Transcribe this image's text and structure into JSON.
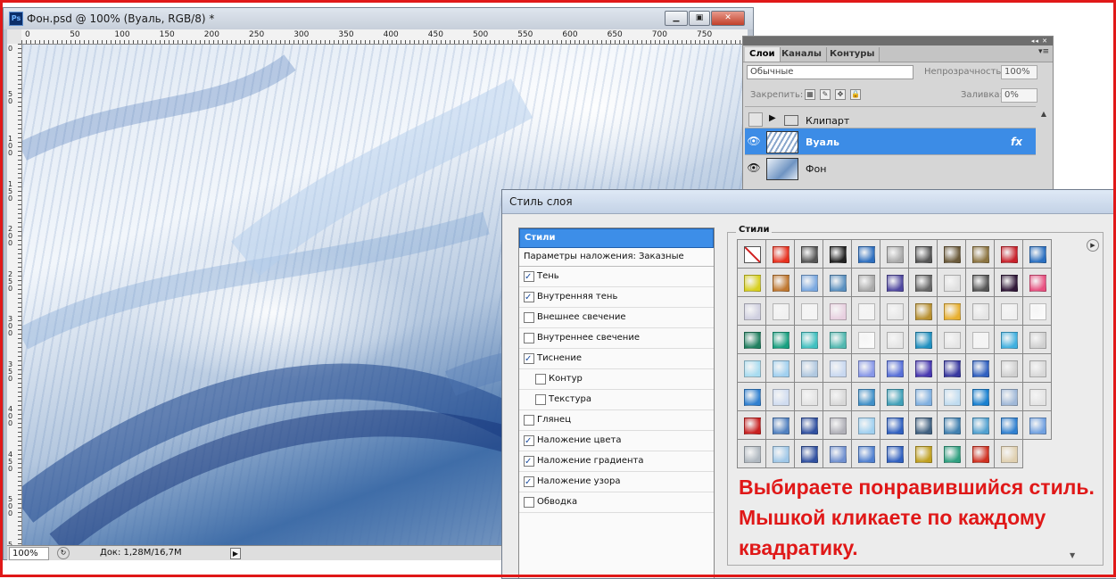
{
  "document": {
    "title": "Фон.psd @ 100% (Вуаль, RGB/8) *",
    "window_buttons": {
      "minimize": "▁",
      "restore": "▣",
      "close": "✕"
    },
    "ruler_top_labels": [
      "0",
      "50",
      "100",
      "150",
      "200",
      "250",
      "300",
      "350",
      "400",
      "450",
      "500",
      "550",
      "600",
      "650",
      "700",
      "750"
    ],
    "ruler_left_labels": [
      "0",
      "5 0",
      "1 0 0",
      "1 5 0",
      "2 0 0",
      "2 5 0",
      "3 0 0",
      "3 5 0",
      "4 0 0",
      "4 5 0",
      "5 0 0",
      "5"
    ],
    "zoom": "100%",
    "doc_info": "Док: 1,28M/16,7M",
    "play_arrow": "▶",
    "zoom_icon": "↻"
  },
  "layers_panel": {
    "collapse_glyph": "◂◂ ✕",
    "tabs": [
      "Слои",
      "Каналы",
      "Контуры"
    ],
    "menu_glyph": "▾≡",
    "blend_mode": "Обычные",
    "opacity_label": "Непрозрачность:",
    "opacity_value": "100%",
    "lock_label": "Закрепить:",
    "lock_icons": [
      "▦",
      "✎",
      "✥",
      "🔒"
    ],
    "fill_label": "Заливка:",
    "fill_value": "0%",
    "layers": [
      {
        "name": "Клипарт",
        "type": "group",
        "visible": false,
        "selected": false
      },
      {
        "name": "Вуаль",
        "type": "layer",
        "visible": true,
        "selected": true,
        "fx": "fx"
      },
      {
        "name": "Фон",
        "type": "layer",
        "visible": true,
        "selected": false
      }
    ],
    "eye_glyph": "👁",
    "expand_glyph": "▶"
  },
  "layer_style_dialog": {
    "title": "Стиль слоя",
    "list_header": "Стили",
    "blend_options": "Параметры наложения: Заказные",
    "options": [
      {
        "label": "Тень",
        "checked": true,
        "sub": false
      },
      {
        "label": "Внутренняя тень",
        "checked": true,
        "sub": false
      },
      {
        "label": "Внешнее свечение",
        "checked": false,
        "sub": false
      },
      {
        "label": "Внутреннее свечение",
        "checked": false,
        "sub": false
      },
      {
        "label": "Тиснение",
        "checked": true,
        "sub": false
      },
      {
        "label": "Контур",
        "checked": false,
        "sub": true
      },
      {
        "label": "Текстура",
        "checked": false,
        "sub": true
      },
      {
        "label": "Глянец",
        "checked": false,
        "sub": false
      },
      {
        "label": "Наложение цвета",
        "checked": true,
        "sub": false
      },
      {
        "label": "Наложение градиента",
        "checked": true,
        "sub": false
      },
      {
        "label": "Наложение узора",
        "checked": true,
        "sub": false
      },
      {
        "label": "Обводка",
        "checked": false,
        "sub": false
      }
    ],
    "styles_legend": "Стили",
    "styles_menu_glyph": "▶",
    "scroll_down_glyph": "▼",
    "style_swatches": [
      [
        "none",
        "#e8301e",
        "#555555",
        "#222222",
        "#2e6fbf",
        "#aaaaaa",
        "#555555",
        "#6b5a3a",
        "#8c7440",
        "#c8202a",
        "#2a6fc0"
      ],
      [
        "#d8d020",
        "#c07830",
        "#7aa8e0",
        "#5a90c0",
        "#aaaaaa",
        "#5048a0",
        "#666666",
        "#e0e0e0",
        "#555555",
        "#301838",
        "#e85080"
      ],
      [
        "#d0d0e0",
        "#f0f0f0",
        "#f4f4f4",
        "#e8d0e0",
        "#f4f4f4",
        "#e8e8e8",
        "#b89030",
        "#e8b030",
        "#e4e4e4",
        "#f0f0f0",
        "#fafafa"
      ],
      [
        "#208060",
        "#18a080",
        "#40c0c0",
        "#50b8b0",
        "#fafafa",
        "#e6e6e6",
        "#2090c0",
        "#e6e6e6",
        "#f4f4f4",
        "#40b0e0",
        "#d0d0d0"
      ],
      [
        "#a8dcf0",
        "#a0d0f0",
        "#b0c8e0",
        "#c8d8f0",
        "#8898e8",
        "#5870d8",
        "#4838b0",
        "#3838a0",
        "#3060c0",
        "#d0d0d0",
        "#d8d8d8"
      ],
      [
        "#3080d0",
        "#d0dcf0",
        "#e4e4e4",
        "#d8d8d8",
        "#4090c8",
        "#40a0b8",
        "#80b0e0",
        "#c0dcf0",
        "#1880d0",
        "#a0b8d8",
        "#e4e4e4"
      ],
      [
        "#c82020",
        "#5080c0",
        "#3050a0",
        "#b0b0b8",
        "#a0d0f0",
        "#3060c0",
        "#406080",
        "#4080b0",
        "#50a0d0",
        "#3080d0",
        "#70a0e0"
      ],
      [
        "#b0b8c0",
        "#a0c8e8",
        "#3050a0",
        "#7090d0",
        "#5080d0",
        "#3060c0",
        "#c0a020",
        "#30a080",
        "#d03020",
        "#e0d0b0",
        "#4080c0"
      ]
    ],
    "annotation": "Выбираете понравившийся стиль. Мышкой кликаете по каждому квадратику."
  }
}
